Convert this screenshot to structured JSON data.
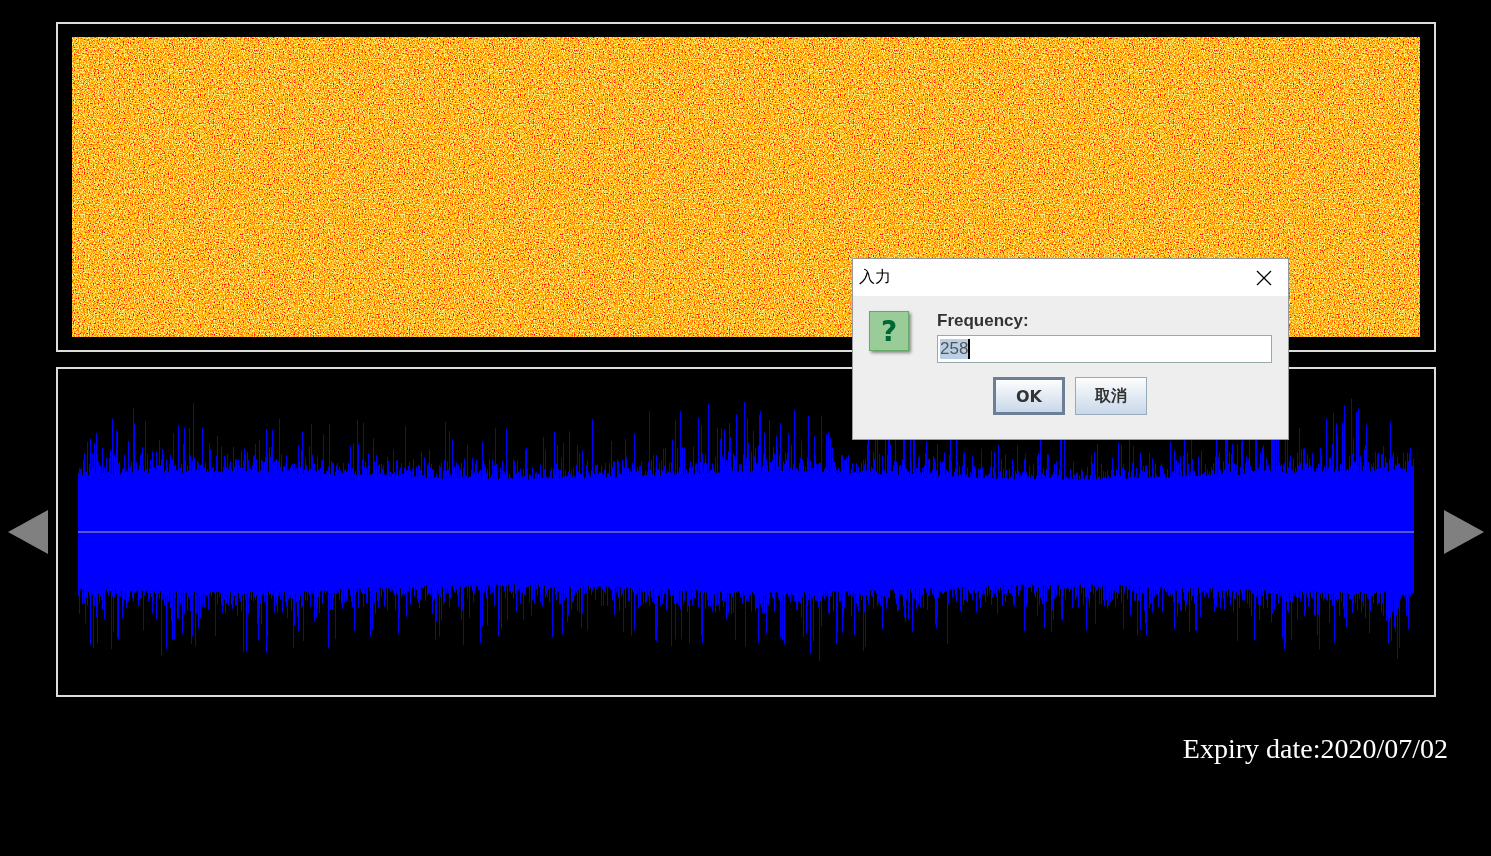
{
  "dialog": {
    "title": "入力",
    "icon": "?",
    "prompt": "Frequency:",
    "input": {
      "value": "258"
    },
    "buttons": [
      {
        "label": "OK",
        "selected": true
      },
      {
        "label": "取消",
        "selected": false
      }
    ]
  },
  "expiry": "Expiry date:2020/07/02"
}
